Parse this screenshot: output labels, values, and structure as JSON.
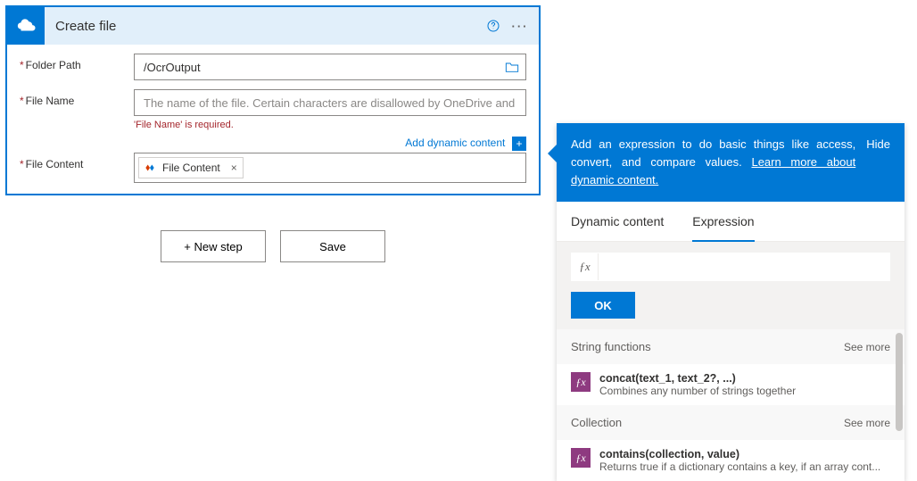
{
  "card": {
    "title": "Create file",
    "fields": {
      "folder": {
        "label": "Folder Path",
        "value": "/OcrOutput"
      },
      "filename": {
        "label": "File Name",
        "placeholder": "The name of the file. Certain characters are disallowed by OneDrive and will be",
        "error": "'File Name' is required."
      },
      "content": {
        "label": "File Content",
        "token": "File Content"
      }
    },
    "add_dynamic": "Add dynamic content"
  },
  "footer": {
    "new_step": "+ New step",
    "save": "Save"
  },
  "panel": {
    "intro": "Add an expression to do basic things like access, convert, and compare values. ",
    "learn": "Learn more about dynamic content.",
    "hide": "Hide",
    "tabs": {
      "dynamic": "Dynamic content",
      "expression": "Expression"
    },
    "ok": "OK",
    "sections": [
      {
        "title": "String functions",
        "see_more": "See more",
        "items": [
          {
            "sig": "concat(text_1, text_2?, ...)",
            "desc": "Combines any number of strings together"
          }
        ]
      },
      {
        "title": "Collection",
        "see_more": "See more",
        "items": [
          {
            "sig": "contains(collection, value)",
            "desc": "Returns true if a dictionary contains a key, if an array cont..."
          }
        ]
      }
    ]
  }
}
